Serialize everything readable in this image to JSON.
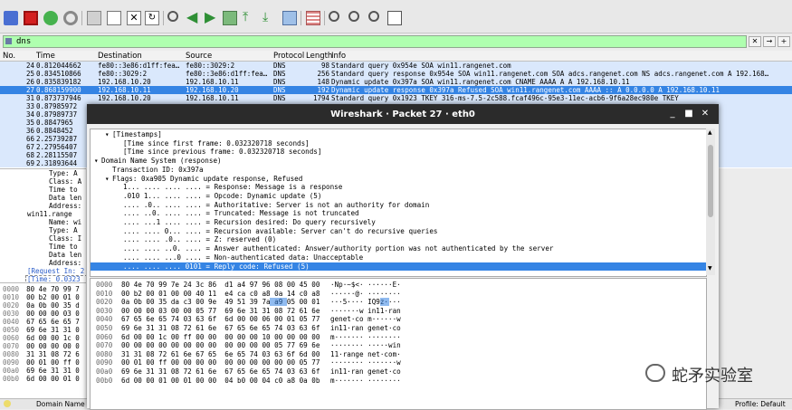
{
  "filter": {
    "value": "dns"
  },
  "packet_list": {
    "columns": [
      "No.",
      "Time",
      "Destination",
      "Source",
      "Protocol",
      "Length",
      "Info"
    ],
    "rows": [
      {
        "no": "24",
        "time": "0.812044662",
        "dst": "fe80::3e86:d1ff:fea…",
        "src": "fe80::3029:2",
        "proto": "DNS",
        "len": "98",
        "info": "Standard query 0x954e SOA win11.rangenet.com",
        "selected": false
      },
      {
        "no": "25",
        "time": "0.834510866",
        "dst": "fe80::3029:2",
        "src": "fe80::3e86:d1ff:fea…",
        "proto": "DNS",
        "len": "256",
        "info": "Standard query response 0x954e SOA win11.rangenet.com SOA adcs.rangenet.com NS adcs.rangenet.com A 192.168…",
        "selected": false
      },
      {
        "no": "26",
        "time": "0.835839182",
        "dst": "192.168.10.20",
        "src": "192.168.10.11",
        "proto": "DNS",
        "len": "148",
        "info": "Dynamic update 0x397a SOA win11.rangenet.com CNAME AAAA A A 192.168.10.11",
        "selected": false
      },
      {
        "no": "27",
        "time": "0.868159900",
        "dst": "192.168.10.11",
        "src": "192.168.10.20",
        "proto": "DNS",
        "len": "192",
        "info": "Dynamic update response 0x397a Refused SOA win11.rangenet.com AAAA :: A 0.0.0.0 A 192.168.10.11",
        "selected": true
      },
      {
        "no": "31",
        "time": "0.873737946",
        "dst": "192.168.10.20",
        "src": "192.168.10.11",
        "proto": "DNS",
        "len": "1794",
        "info": "Standard query 0x1923 TKEY 316-ms-7.5-2c588.fcaf496c-95e3-11ec-acb6-9f6a28ec980e TKEY",
        "selected": false
      },
      {
        "no": "33",
        "time": "0.87985972",
        "dst": "",
        "src": "",
        "proto": "",
        "len": "",
        "info": "",
        "selected": false
      },
      {
        "no": "34",
        "time": "0.87989737",
        "dst": "",
        "src": "",
        "proto": "",
        "len": "",
        "info": "",
        "selected": false
      },
      {
        "no": "35",
        "time": "0.8847965",
        "dst": "",
        "src": "",
        "proto": "",
        "len": "",
        "info": "",
        "selected": false
      },
      {
        "no": "36",
        "time": "0.8848452",
        "dst": "",
        "src": "",
        "proto": "",
        "len": "",
        "info": ".com win11.rangenet.com NS adcs.rangenet.com A 192.168…",
        "selected": false
      },
      {
        "no": "66",
        "time": "2.25739287",
        "dst": "",
        "src": "",
        "proto": "",
        "len": "",
        "info": "",
        "selected": false
      },
      {
        "no": "67",
        "time": "2.27956407",
        "dst": "",
        "src": "",
        "proto": "",
        "len": "",
        "info": ".com",
        "selected": false
      },
      {
        "no": "68",
        "time": "2.28115507",
        "dst": "",
        "src": "",
        "proto": "",
        "len": "",
        "info": "",
        "selected": false
      },
      {
        "no": "69",
        "time": "2.31893644",
        "dst": "",
        "src": "",
        "proto": "",
        "len": "",
        "info": "11",
        "selected": false
      }
    ]
  },
  "left_details": [
    "Type: A",
    "Class: A",
    "Time to",
    "Data len",
    "Address:",
    "win11.range",
    "Name: wi",
    "Type: A",
    "Class: I",
    "Time to",
    "Data len",
    "Address:",
    "[Request In: 2",
    "[Time: 0.0323"
  ],
  "left_bytes": [
    {
      "off": "0000",
      "hex": "80 4e 70 99 7"
    },
    {
      "off": "0010",
      "hex": "00 b2 00 01 0"
    },
    {
      "off": "0020",
      "hex": "0a 0b 00 35 d"
    },
    {
      "off": "0030",
      "hex": "00 00 00 03 0"
    },
    {
      "off": "0040",
      "hex": "67 65 6e 65 7"
    },
    {
      "off": "0050",
      "hex": "69 6e 31 31 0"
    },
    {
      "off": "0060",
      "hex": "6d 00 00 1c 0"
    },
    {
      "off": "0070",
      "hex": "00 00 00 00 0"
    },
    {
      "off": "0080",
      "hex": "31 31 08 72 6"
    },
    {
      "off": "0090",
      "hex": "00 01 00 ff 0"
    },
    {
      "off": "00a0",
      "hex": "69 6e 31 31 0"
    },
    {
      "off": "00b0",
      "hex": "6d 00 00 01 0"
    }
  ],
  "status": {
    "left": "Domain Name",
    "right": "Profile: Default"
  },
  "popup": {
    "title": "Wireshark · Packet 27 · eth0",
    "details": [
      {
        "indent": 2,
        "tri": "▾",
        "text": "[Timestamps]"
      },
      {
        "indent": 4,
        "tri": "",
        "text": "[Time since first frame: 0.032320718 seconds]"
      },
      {
        "indent": 4,
        "tri": "",
        "text": "[Time since previous frame: 0.032320718 seconds]"
      },
      {
        "indent": 0,
        "tri": "▾",
        "text": "Domain Name System (response)"
      },
      {
        "indent": 2,
        "tri": "",
        "text": "Transaction ID: 0x397a"
      },
      {
        "indent": 2,
        "tri": "▾",
        "text": "Flags: 0xa905 Dynamic update response, Refused"
      },
      {
        "indent": 4,
        "tri": "",
        "text": "1... .... .... .... = Response: Message is a response"
      },
      {
        "indent": 4,
        "tri": "",
        "text": ".010 1... .... .... = Opcode: Dynamic update (5)"
      },
      {
        "indent": 4,
        "tri": "",
        "text": ".... .0.. .... .... = Authoritative: Server is not an authority for domain"
      },
      {
        "indent": 4,
        "tri": "",
        "text": ".... ..0. .... .... = Truncated: Message is not truncated"
      },
      {
        "indent": 4,
        "tri": "",
        "text": ".... ...1 .... .... = Recursion desired: Do query recursively"
      },
      {
        "indent": 4,
        "tri": "",
        "text": ".... .... 0... .... = Recursion available: Server can't do recursive queries"
      },
      {
        "indent": 4,
        "tri": "",
        "text": ".... .... .0.. .... = Z: reserved (0)"
      },
      {
        "indent": 4,
        "tri": "",
        "text": ".... .... ..0. .... = Answer authenticated: Answer/authority portion was not authenticated by the server"
      },
      {
        "indent": 4,
        "tri": "",
        "text": ".... .... ...0 .... = Non-authenticated data: Unacceptable"
      },
      {
        "indent": 4,
        "tri": "",
        "text": ".... .... .... 0101 = Reply code: Refused (5)",
        "selected": true
      }
    ],
    "bytes": [
      {
        "off": "0000",
        "hex": "80 4e 70 99 7e 24 3c 86  d1 a4 97 96 08 00 45 00",
        "ascii": "·Np·~$<· ······E·"
      },
      {
        "off": "0010",
        "hex": "00 b2 00 01 00 00 40 11  e4 ca c0 a8 0a 14 c0 a8",
        "ascii": "······@· ········"
      },
      {
        "off": "0020",
        "hex": "0a 0b 00 35 da c3 00 9e  49 51 39 7a a9 05 00 01",
        "ascii": "···5···· IQ9z····"
      },
      {
        "off": "0030",
        "hex": "00 00 00 03 00 00 05 77  69 6e 31 31 08 72 61 6e",
        "ascii": "·······w in11·ran"
      },
      {
        "off": "0040",
        "hex": "67 65 6e 65 74 03 63 6f  6d 00 00 06 00 01 05 77",
        "ascii": "genet·co m······w"
      },
      {
        "off": "0050",
        "hex": "69 6e 31 31 08 72 61 6e  67 65 6e 65 74 03 63 6f",
        "ascii": "in11·ran genet·co"
      },
      {
        "off": "0060",
        "hex": "6d 00 00 1c 00 ff 00 00  00 00 00 10 00 00 00 00",
        "ascii": "m······· ········"
      },
      {
        "off": "0070",
        "hex": "00 00 00 00 00 00 00 00  00 00 00 00 05 77 69 6e",
        "ascii": "········ ·····win"
      },
      {
        "off": "0080",
        "hex": "31 31 08 72 61 6e 67 65  6e 65 74 03 63 6f 6d 00",
        "ascii": "11·range net·com·"
      },
      {
        "off": "0090",
        "hex": "00 01 00 ff 00 00 00 00  00 00 00 00 00 00 05 77",
        "ascii": "········ ·······w"
      },
      {
        "off": "00a0",
        "hex": "69 6e 31 31 08 72 61 6e  67 65 6e 65 74 03 63 6f",
        "ascii": "in11·ran genet·co"
      },
      {
        "off": "00b0",
        "hex": "6d 00 00 01 00 01 00 00  04 b0 00 04 c0 a8 0a 0b",
        "ascii": "m······· ········"
      }
    ]
  },
  "watermark": {
    "text": "蛇矛实验室"
  },
  "colors": {
    "selected": "#3584e4",
    "dns_row": "#dae8fc",
    "filter_ok": "#afffaf",
    "titlebar": "#2b2b2b"
  }
}
